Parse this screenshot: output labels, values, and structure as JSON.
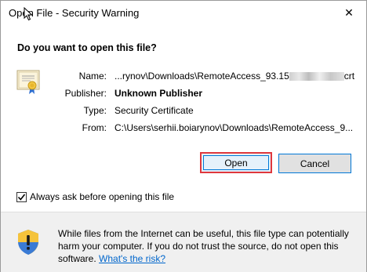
{
  "window": {
    "title": "Open File - Security Warning",
    "close_glyph": "✕"
  },
  "question": "Do you want to open this file?",
  "details": {
    "name_label": "Name:",
    "name_prefix": "...rynov\\Downloads\\RemoteAccess_93.15",
    "name_suffix": "crt",
    "publisher_label": "Publisher:",
    "publisher_value": "Unknown Publisher",
    "type_label": "Type:",
    "type_value": "Security Certificate",
    "from_label": "From:",
    "from_value": "C:\\Users\\serhii.boiarynov\\Downloads\\RemoteAccess_9..."
  },
  "buttons": {
    "open_label": "Open",
    "cancel_label": "Cancel"
  },
  "checkbox": {
    "label": "Always ask before opening this file",
    "checked": true
  },
  "footer": {
    "warning_text": "While files from the Internet can be useful, this file type can potentially harm your computer. If you do not trust the source, do not open this software. ",
    "link_text": "What's the risk?"
  },
  "colors": {
    "accent_blue": "#0078d7",
    "highlight_red": "#e0383d",
    "link_blue": "#0066cc",
    "footer_bg": "#f0f0f0"
  },
  "icons": [
    "certificate-icon",
    "close-icon",
    "checkmark-icon",
    "security-shield-icon",
    "mouse-cursor-icon"
  ]
}
